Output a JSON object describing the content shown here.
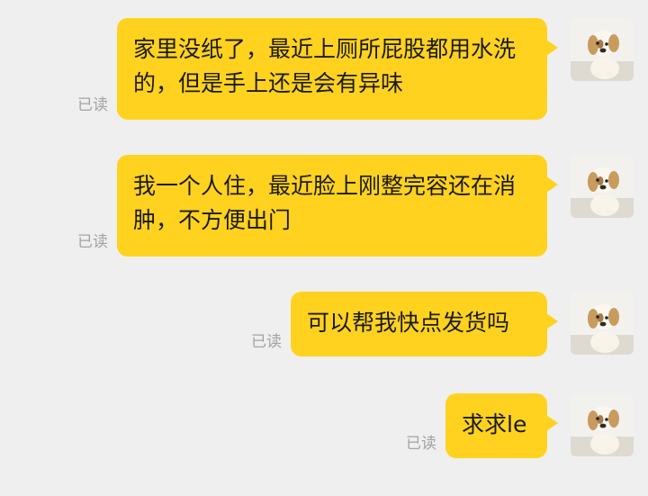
{
  "messages": [
    {
      "text": "家里没纸了，最近上厕所屁股都用水洗的，但是手上还是会有异味",
      "status": "已读"
    },
    {
      "text": "我一个人住，最近脸上刚整完容还在消肿，不方便出门",
      "status": "已读"
    },
    {
      "text": "可以帮我快点发货吗",
      "status": "已读"
    },
    {
      "text": "求求le",
      "status": "已读"
    }
  ],
  "avatar": {
    "icon": "puppy-avatar-icon"
  },
  "colors": {
    "background": "#efefef",
    "bubble": "#ffd21f",
    "read_status": "#a3a3a3"
  }
}
